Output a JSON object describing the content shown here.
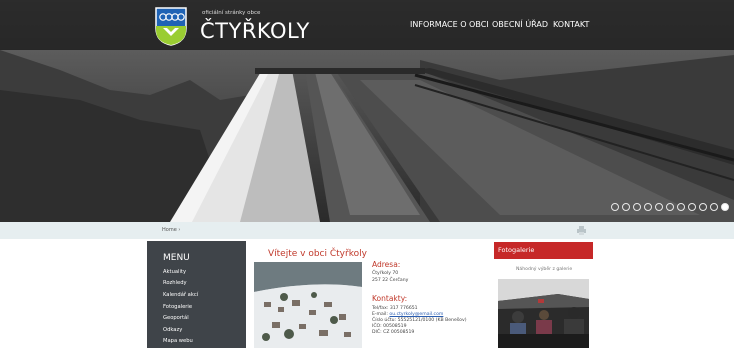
{
  "site": {
    "tagline": "oficiální stránky obce",
    "brand": "ČTYŘKOLY"
  },
  "nav": [
    "INFORMACE O OBCI",
    "OBECNÍ ÚŘAD",
    "KONTAKT"
  ],
  "slider": {
    "dot_count": 11,
    "active_index": 10
  },
  "breadcrumb": "Home ›",
  "menu": {
    "title": "MENU",
    "items": [
      "Aktuality",
      "Rozhledy",
      "Kalendář akcí",
      "Fotogalerie",
      "Geoportál",
      "Odkazy",
      "Mapa webu"
    ]
  },
  "main": {
    "welcome": "Vítejte v obci Čtyřkoly",
    "address_heading": "Adresa:",
    "address_lines": [
      "Čtyřkoly 70",
      "257 22 Čerčany"
    ],
    "contacts_heading": "Kontakty:",
    "phone": "Tel/fax: 317 776651",
    "email_label": "E-mail: ",
    "email": "ou.ctyrkoly@email.com",
    "account": "Číslo účtu: 55525121/0100 (KB Benešov)",
    "ico": "IČO: 00508519",
    "dic": "DIČ: CZ 00508519"
  },
  "gallery": {
    "title": "Fotogalerie",
    "subtitle": "Náhodný výběr z galerie"
  },
  "colors": {
    "accent": "#c62828",
    "menu_bg": "#3f4449",
    "link": "#2a5db0"
  }
}
